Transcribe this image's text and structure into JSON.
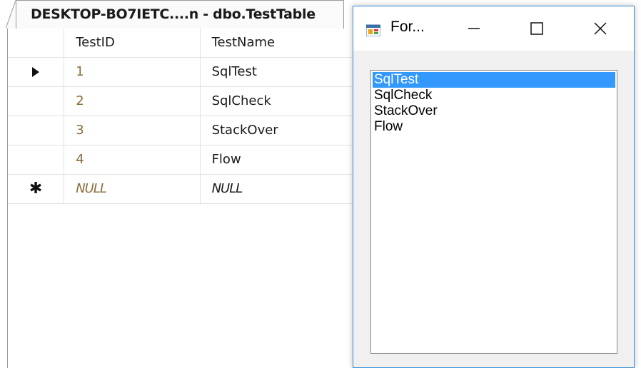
{
  "document_tab": {
    "title": "DESKTOP-BO7IETC....n - dbo.TestTable"
  },
  "grid": {
    "columns": [
      "TestID",
      "TestName"
    ],
    "rows": [
      {
        "marker": "▶",
        "id": "1",
        "name": "SqlTest"
      },
      {
        "marker": "",
        "id": "2",
        "name": "SqlCheck"
      },
      {
        "marker": "",
        "id": "3",
        "name": "StackOver"
      },
      {
        "marker": "",
        "id": "4",
        "name": "Flow"
      },
      {
        "marker": "✱",
        "id": "NULL",
        "name": "NULL"
      }
    ],
    "current_row_marker_icon": "play-arrow-icon",
    "new_row_marker_icon": "asterisk-icon",
    "id_text_color": "#8a6d3b"
  },
  "form": {
    "title": "For...",
    "icon": "winforms-app-icon",
    "buttons": [
      "minimize-icon",
      "maximize-icon",
      "close-icon"
    ],
    "accent_border_color": "#3a8fd6",
    "listbox": {
      "items": [
        "SqlTest",
        "SqlCheck",
        "StackOver",
        "Flow"
      ],
      "selected_index": 0,
      "selection_color": "#3399ff"
    }
  }
}
